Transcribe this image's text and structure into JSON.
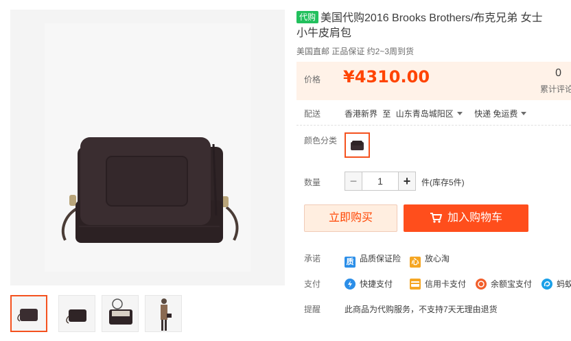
{
  "gallery": {
    "main_image": "product-bag-image",
    "thumbnails": [
      "bag-front-thumb",
      "bag-side-thumb",
      "bag-open-thumb",
      "model-wearing-thumb"
    ]
  },
  "product": {
    "tag": "代购",
    "title_line1": "美国代购2016 Brooks Brothers/布克兄弟 女士",
    "title_line2": "小牛皮肩包",
    "subtitle": "美国直邮 正品保证 约2~3周到货"
  },
  "price": {
    "label": "价格",
    "value": "¥4310.00",
    "review_count": "0",
    "review_label": "累计评论"
  },
  "shipping": {
    "label": "配送",
    "from": "香港新界",
    "to_word": "至",
    "destination": "山东青岛城阳区",
    "method": "快递 免运费"
  },
  "color": {
    "label": "颜色分类"
  },
  "quantity": {
    "label": "数量",
    "minus": "−",
    "value": "1",
    "plus": "+",
    "stock": "件(库存5件)"
  },
  "actions": {
    "buy_now": "立即购买",
    "add_cart": "加入购物车"
  },
  "promise": {
    "label": "承诺",
    "items": [
      {
        "icon": "质",
        "text": "品质保证险",
        "color": "#2b8ee8"
      },
      {
        "icon": "心",
        "text": "放心淘",
        "color": "#f5a623"
      }
    ]
  },
  "payment": {
    "label": "支付",
    "items": [
      {
        "text": "快捷支付",
        "color": "#2b8ee8"
      },
      {
        "text": "信用卡支付",
        "color": "#f5a623"
      },
      {
        "text": "余额宝支付",
        "color": "#f25f2b"
      },
      {
        "text": "蚂蚁",
        "color": "#1aa0e8"
      }
    ]
  },
  "reminder": {
    "label": "提醒",
    "text": "此商品为代购服务，不支持7天无理由退货"
  }
}
